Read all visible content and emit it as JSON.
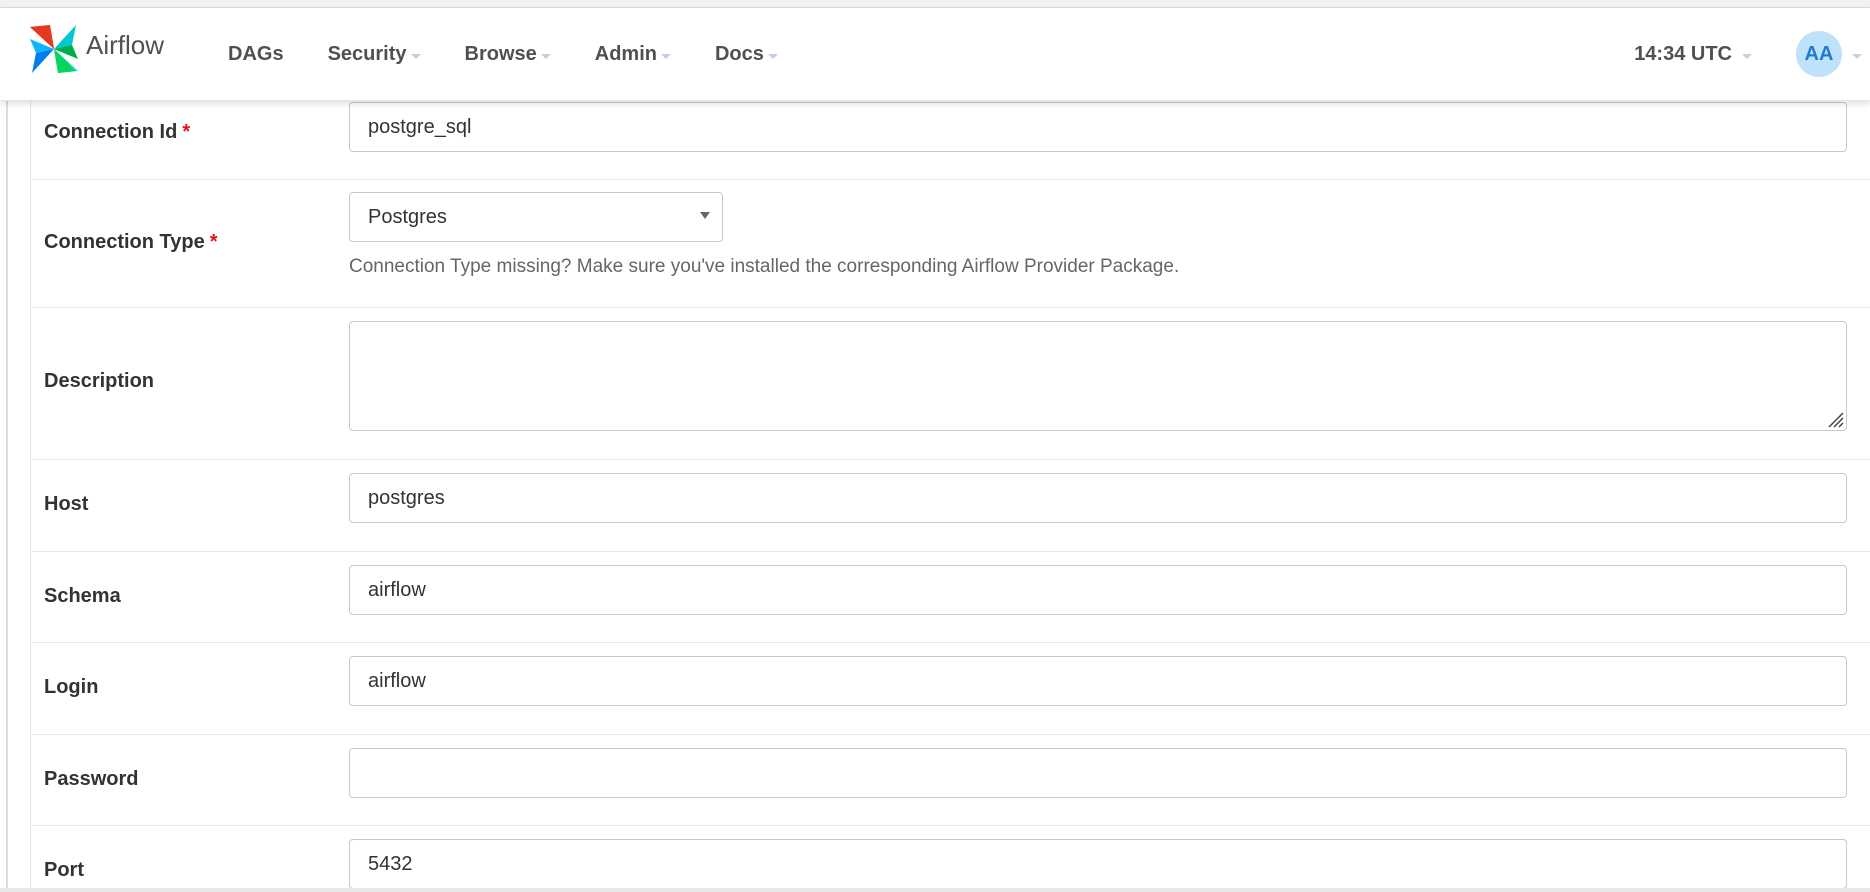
{
  "app": {
    "brand": "Airflow"
  },
  "nav": {
    "items": [
      {
        "label": "DAGs"
      },
      {
        "label": "Security"
      },
      {
        "label": "Browse"
      },
      {
        "label": "Admin"
      },
      {
        "label": "Docs"
      }
    ],
    "clock": "14:34 UTC",
    "user_initials": "AA"
  },
  "form": {
    "connection_id": {
      "label": "Connection Id",
      "required_mark": "*",
      "value": "postgre_sql"
    },
    "connection_type": {
      "label": "Connection Type",
      "required_mark": "*",
      "value": "Postgres",
      "help": "Connection Type missing? Make sure you've installed the corresponding Airflow Provider Package."
    },
    "description": {
      "label": "Description",
      "value": ""
    },
    "host": {
      "label": "Host",
      "value": "postgres"
    },
    "schema": {
      "label": "Schema",
      "value": "airflow"
    },
    "login": {
      "label": "Login",
      "value": "airflow"
    },
    "password": {
      "label": "Password",
      "value": ""
    },
    "port": {
      "label": "Port",
      "value": "5432"
    }
  },
  "colors": {
    "brand_text": "#51504f",
    "required": "#e0121a",
    "avatar_bg": "#bfe2fb",
    "avatar_text": "#1f7ad1"
  },
  "icons": {
    "logo": "airflow-pinwheel-icon",
    "dropdown": "chevron-down-icon",
    "resize": "resize-grip-icon"
  }
}
